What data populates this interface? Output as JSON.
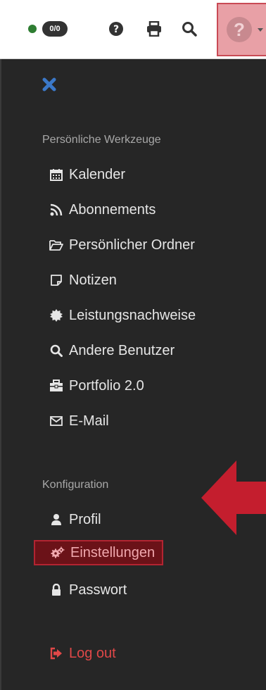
{
  "topbar": {
    "counter_badge": "0/0",
    "icons": [
      "status-dot",
      "question-circle-icon",
      "print-icon",
      "search-icon",
      "help-menu-icon"
    ]
  },
  "menu": {
    "close_icon": "close-x-icon",
    "sections": [
      {
        "title": "Persönliche Werkzeuge",
        "items": [
          {
            "label": "Kalender",
            "icon": "calendar-icon"
          },
          {
            "label": "Abonnements",
            "icon": "rss-icon"
          },
          {
            "label": "Persönlicher Ordner",
            "icon": "folder-open-icon"
          },
          {
            "label": "Notizen",
            "icon": "note-icon"
          },
          {
            "label": "Leistungsnachweise",
            "icon": "certificate-icon"
          },
          {
            "label": "Andere Benutzer",
            "icon": "search-icon"
          },
          {
            "label": "Portfolio 2.0",
            "icon": "briefcase-icon"
          },
          {
            "label": "E-Mail",
            "icon": "envelope-icon"
          }
        ]
      },
      {
        "title": "Konfiguration",
        "items": [
          {
            "label": "Profil",
            "icon": "user-icon"
          },
          {
            "label": "Einstellungen",
            "icon": "gears-icon",
            "active": true
          },
          {
            "label": "Passwort",
            "icon": "lock-icon"
          }
        ]
      }
    ],
    "logout": {
      "label": "Log out",
      "icon": "sign-out-icon"
    }
  },
  "colors": {
    "panel_bg": "#262626",
    "highlight_bg": "#6b1218",
    "highlight_border": "#b32431",
    "logout_red": "#e04848",
    "arrow_red": "#c41e2e"
  }
}
